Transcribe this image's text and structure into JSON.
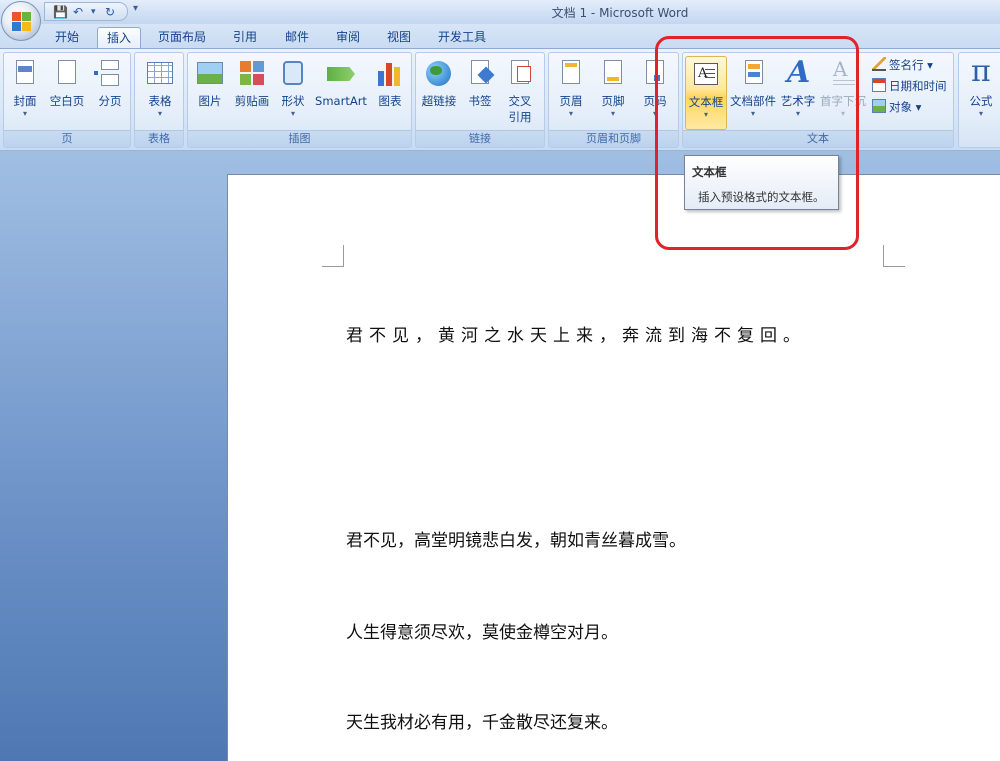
{
  "window": {
    "title": "文档 1 - Microsoft Word"
  },
  "quick_access": {
    "save": "💾",
    "undo": "↶",
    "redo": "↻",
    "dropdown": "▾"
  },
  "tabs": [
    {
      "label": "开始"
    },
    {
      "label": "插入"
    },
    {
      "label": "页面布局"
    },
    {
      "label": "引用"
    },
    {
      "label": "邮件"
    },
    {
      "label": "审阅"
    },
    {
      "label": "视图"
    },
    {
      "label": "开发工具"
    }
  ],
  "active_tab": "插入",
  "ribbon": {
    "groups": {
      "page": {
        "label": "页",
        "cover": "封面",
        "blank": "空白页",
        "break": "分页"
      },
      "table": {
        "label": "表格",
        "table": "表格"
      },
      "illustrations": {
        "label": "插图",
        "picture": "图片",
        "clipart": "剪贴画",
        "shapes": "形状",
        "smartart": "SmartArt",
        "chart": "图表"
      },
      "links": {
        "label": "链接",
        "hyperlink": "超链接",
        "bookmark": "书签",
        "crossref_1": "交叉",
        "crossref_2": "引用"
      },
      "header_footer": {
        "label": "页眉和页脚",
        "header": "页眉",
        "footer": "页脚",
        "pagenum": "页码"
      },
      "text": {
        "label": "文本",
        "textbox": "文本框",
        "quickparts": "文档部件",
        "wordart": "艺术字",
        "dropcap": "首字下沉",
        "signature": "签名行",
        "datetime": "日期和时间",
        "object": "对象"
      },
      "symbols": {
        "equation": "公式",
        "pi": "π"
      }
    }
  },
  "tooltip": {
    "title": "文本框",
    "description": "插入预设格式的文本框。"
  },
  "document": {
    "paragraphs": [
      "君不见，黄河之水天上来，奔流到海不复回。",
      "君不见，高堂明镜悲白发，朝如青丝暮成雪。",
      "人生得意须尽欢，莫使金樽空对月。",
      "天生我材必有用，千金散尽还复来。"
    ]
  },
  "colors": {
    "ribbon_text": "#15428b",
    "highlight": "#ffd55c",
    "annotation": "#e0222b"
  }
}
